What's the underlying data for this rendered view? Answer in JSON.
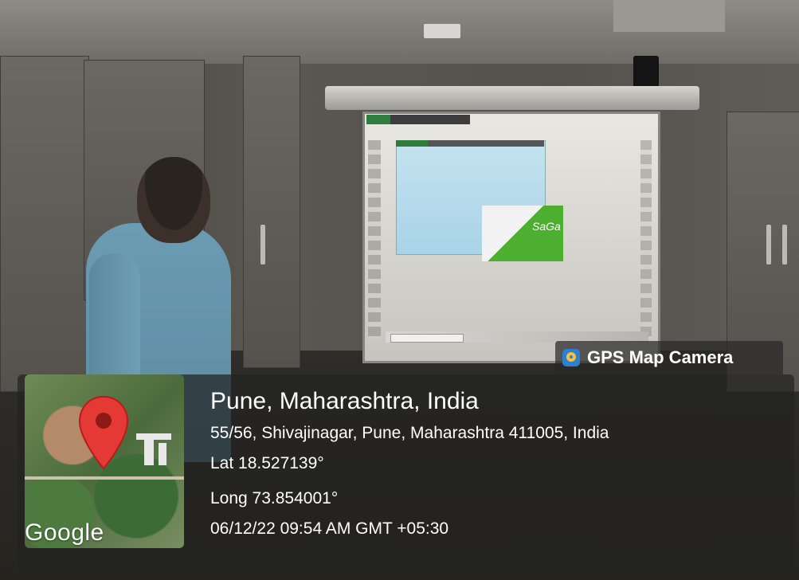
{
  "overlay": {
    "brand": {
      "label": "GPS Map Camera",
      "icon": "gps-map-camera-icon"
    },
    "location": {
      "title": "Pune, Maharashtra, India",
      "address": "55/56, Shivajinagar, Pune, Maharashtra 411005, India",
      "lat": "Lat 18.527139°",
      "long": "Long 73.854001°",
      "datetime": "06/12/22 09:54 AM GMT +05:30"
    },
    "map": {
      "attribution": "Google",
      "pin_color": "#e53935"
    }
  },
  "screen": {
    "logo_text": "SaGa"
  }
}
